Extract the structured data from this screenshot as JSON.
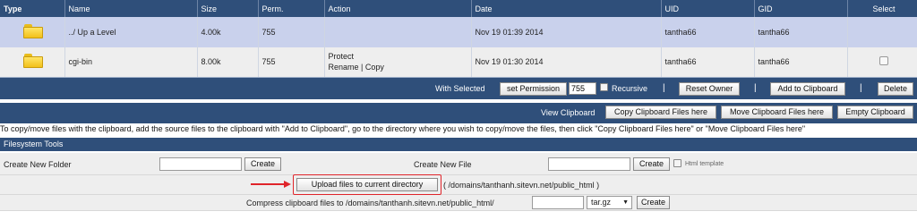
{
  "table": {
    "headers": {
      "type": "Type",
      "name": "Name",
      "size": "Size",
      "perm": "Perm.",
      "action": "Action",
      "date": "Date",
      "uid": "UID",
      "gid": "GID",
      "select": "Select"
    },
    "rows": [
      {
        "icon": "folder-icon",
        "name": "../ Up a Level",
        "size": "4.00k",
        "perm": "755",
        "action_line1": "",
        "action_line2": "",
        "date": "Nov 19 01:39 2014",
        "uid": "tantha66",
        "gid": "tantha66",
        "selectable": false
      },
      {
        "icon": "folder-icon",
        "name": "cgi-bin",
        "size": "8.00k",
        "perm": "755",
        "action_line1": "Protect",
        "action_line2": "Rename | Copy",
        "date": "Nov 19 01:30 2014",
        "uid": "tantha66",
        "gid": "tantha66",
        "selectable": true
      }
    ]
  },
  "selected_bar": {
    "label": "With Selected",
    "set_permission": "set Permission",
    "permission_value": "755",
    "recursive": "Recursive",
    "separator": "|",
    "reset_owner": "Reset Owner",
    "add_to_clipboard": "Add to Clipboard",
    "delete": "Delete"
  },
  "clipboard_bar": {
    "label": "View Clipboard",
    "copy_here": "Copy Clipboard Files here",
    "move_here": "Move Clipboard Files here",
    "empty": "Empty Clipboard"
  },
  "help_text": "To copy/move files with the clipboard, add the source files to the clipboard with \"Add to Clipboard\", go to the directory where you wish to copy/move the files, then click \"Copy Clipboard Files here\" or \"Move Clipboard Files here\"",
  "filesystem_tools": {
    "title": "Filesystem Tools",
    "create_folder_label": "Create New Folder",
    "create_folder_value": "",
    "create_button": "Create",
    "create_file_label": "Create New File",
    "create_file_value": "",
    "html_template": "Html template",
    "upload_button": "Upload files to current directory",
    "upload_path": "( /domains/tanthanh.sitevn.net/public_html )",
    "compress_label": "Compress clipboard files to /domains/tanthanh.sitevn.net/public_html/",
    "compress_value": "",
    "archive_format": "tar.gz"
  },
  "colors": {
    "header_bg": "#2f4f7a",
    "row_highlight": "#c9d1ec",
    "row_normal": "#eeeeee",
    "annotation_red": "#e0242a"
  }
}
